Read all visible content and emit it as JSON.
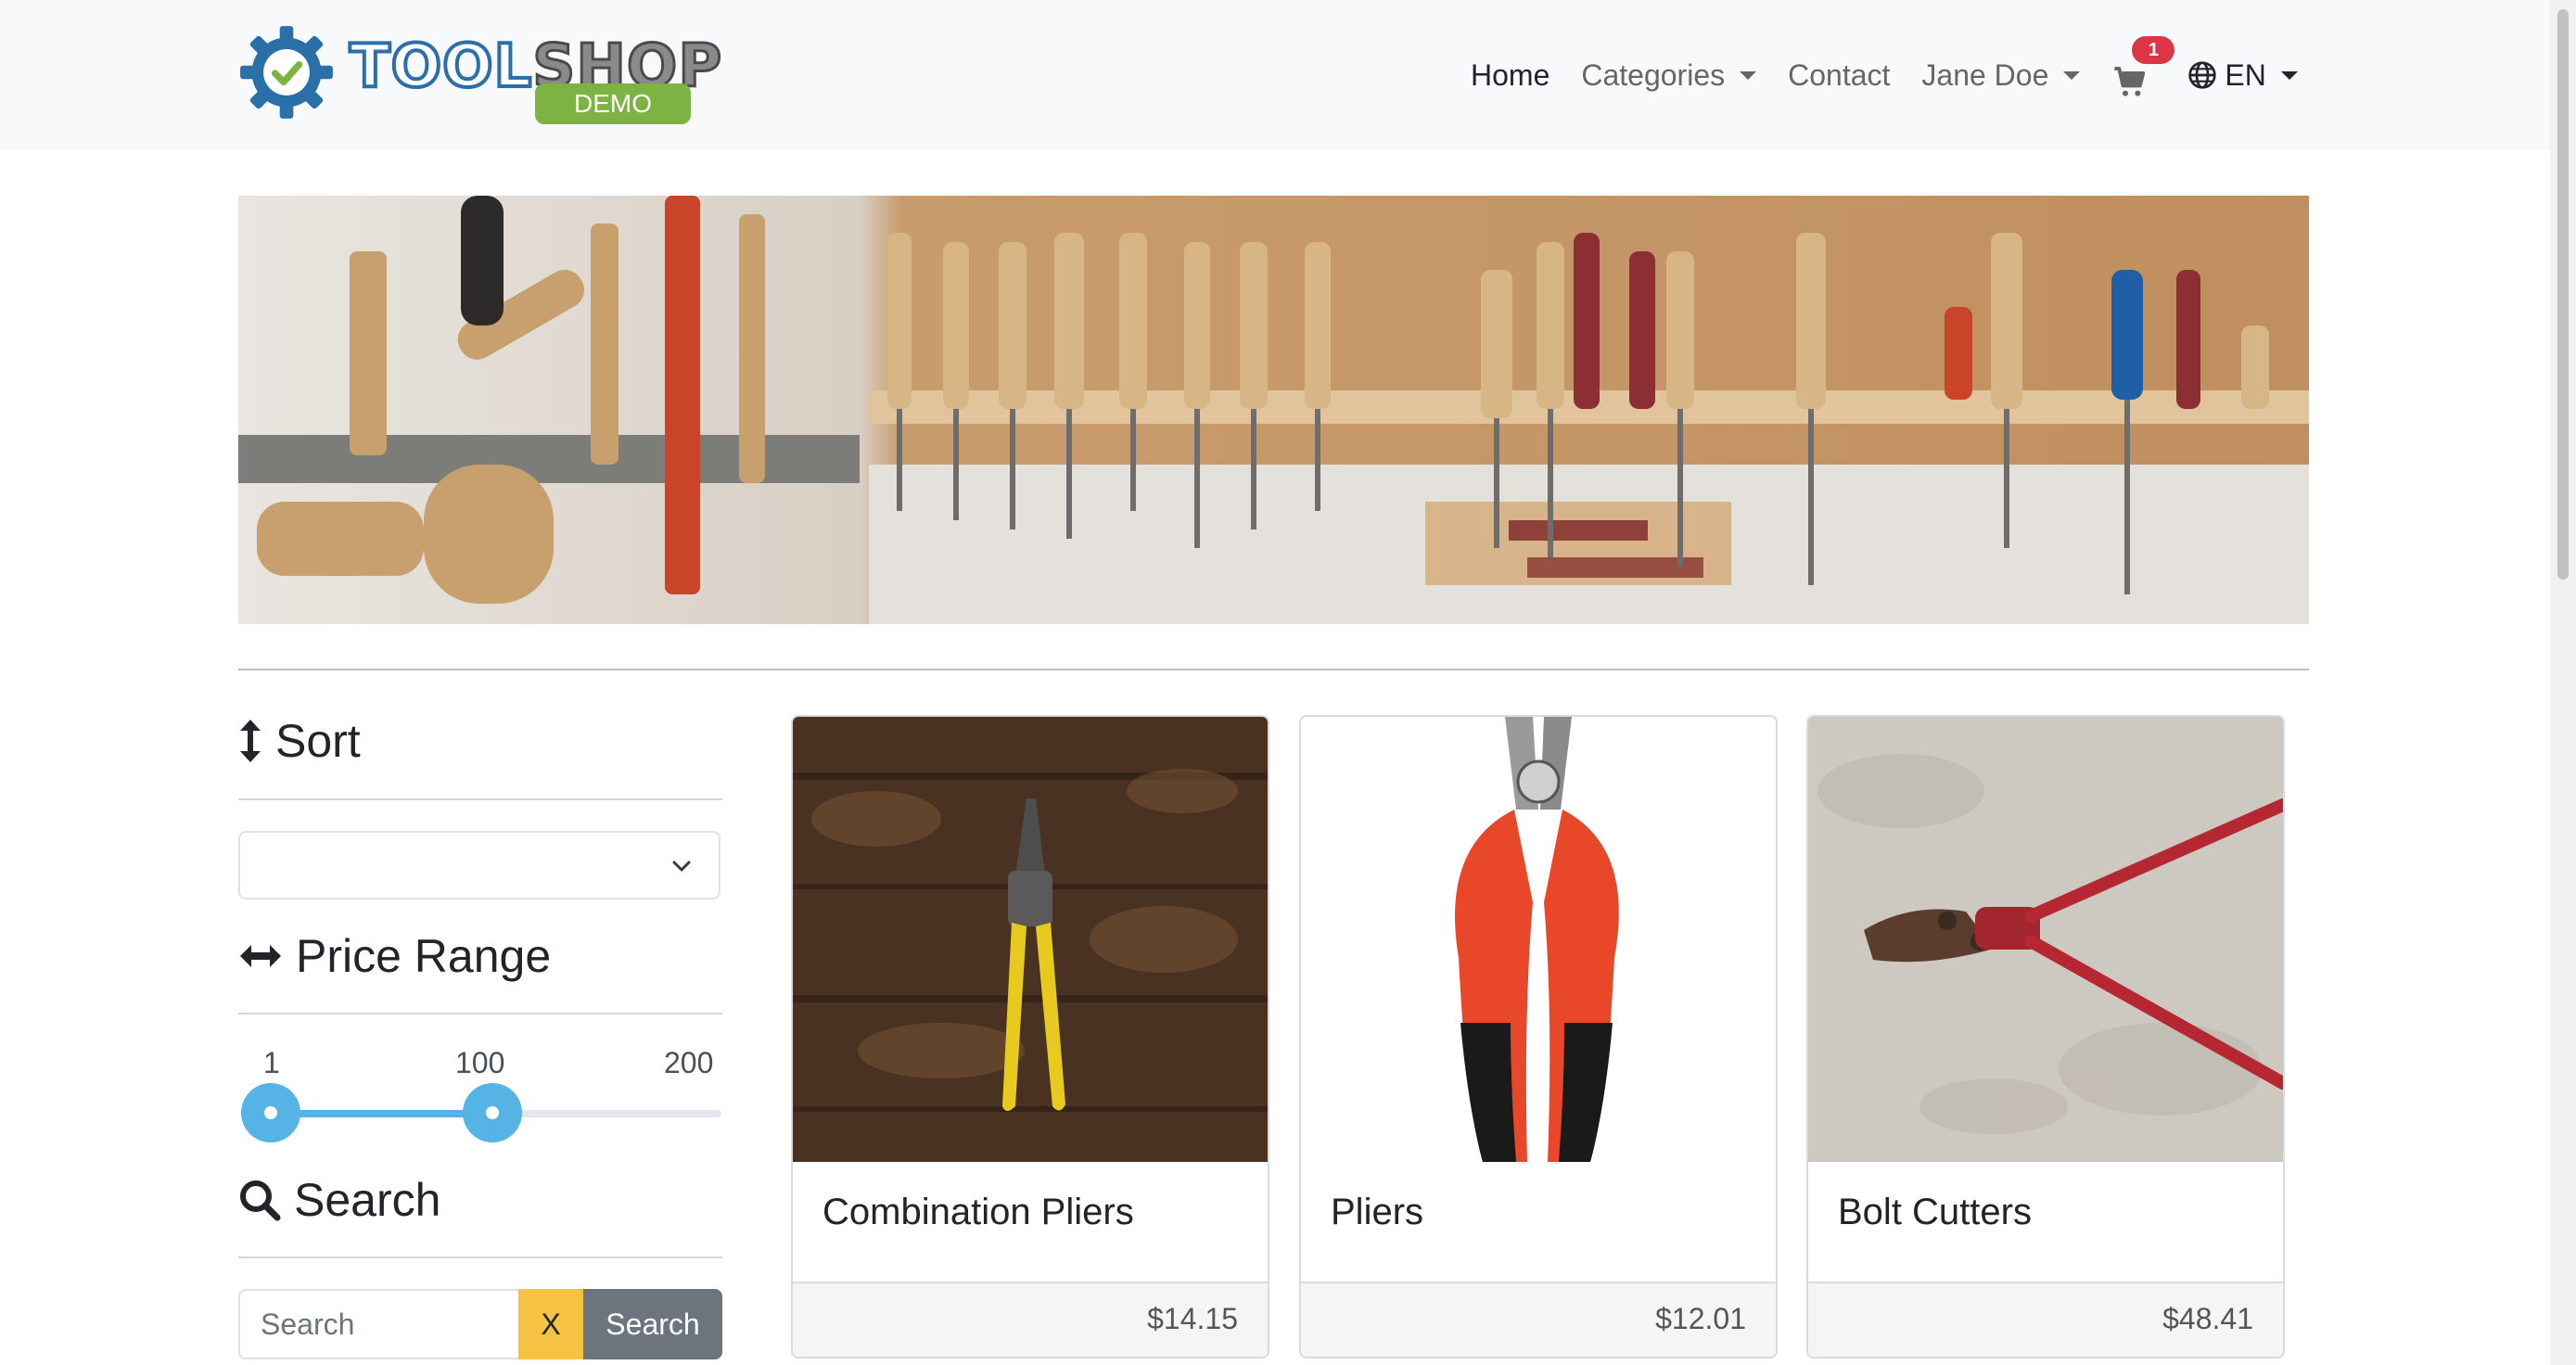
{
  "brand": {
    "name_part1": "TOOL",
    "name_part2": "SHOP",
    "badge": "DEMO"
  },
  "nav": {
    "home": "Home",
    "categories": "Categories",
    "contact": "Contact",
    "user": "Jane Doe",
    "cart_count": "1",
    "language": "EN"
  },
  "banner": {
    "icon": "tool-wall-photo"
  },
  "sidebar": {
    "sort_heading": "Sort",
    "sort_selected": "",
    "price_heading": "Price Range",
    "price_min_label": "1",
    "price_max_label": "200",
    "price_selected_max": "100",
    "price_selected_min_value": 1,
    "price_selected_max_value": 100,
    "search_heading": "Search",
    "search_placeholder": "Search",
    "clear_label": "X",
    "search_button": "Search"
  },
  "products": [
    {
      "name": "Combination Pliers",
      "price": "$14.15"
    },
    {
      "name": "Pliers",
      "price": "$12.01"
    },
    {
      "name": "Bolt Cutters",
      "price": "$48.41"
    }
  ],
  "colors": {
    "accent": "#56b3e5",
    "badge": "#dc3545",
    "clear": "#f5c242",
    "search": "#6c757d",
    "brand_green": "#7cb342"
  }
}
